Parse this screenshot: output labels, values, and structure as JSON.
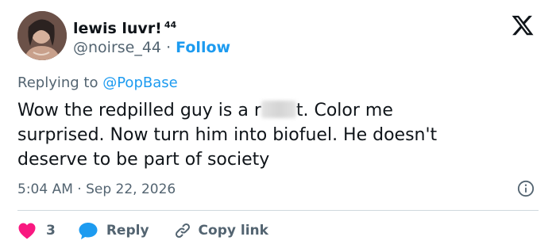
{
  "user": {
    "display_name": "lewis luvr!",
    "badge": "44",
    "handle": "@noirse_44",
    "separator": "·",
    "follow_label": "Follow"
  },
  "reply_context": {
    "prefix": "Replying to",
    "mention": "@PopBase"
  },
  "tweet": {
    "line1_before": "Wow the redpilled guy is a r",
    "line1_after": "t. Color me",
    "line2": "surprised. Now turn him into biofuel. He doesn't",
    "line3": "deserve to be part of society",
    "timestamp": "5:04 AM · Sep 22, 2026"
  },
  "actions": {
    "like_count": "3",
    "reply_label": "Reply",
    "copy_link_label": "Copy link"
  },
  "icons": {
    "logo": "x-logo-icon",
    "like": "heart-icon",
    "reply": "speech-bubble-icon",
    "copy": "link-icon",
    "info": "info-icon"
  },
  "colors": {
    "accent": "#1d9bf0",
    "like": "#f91880",
    "text": "#0f1419",
    "muted": "#536471",
    "divider": "#cfd9de"
  }
}
